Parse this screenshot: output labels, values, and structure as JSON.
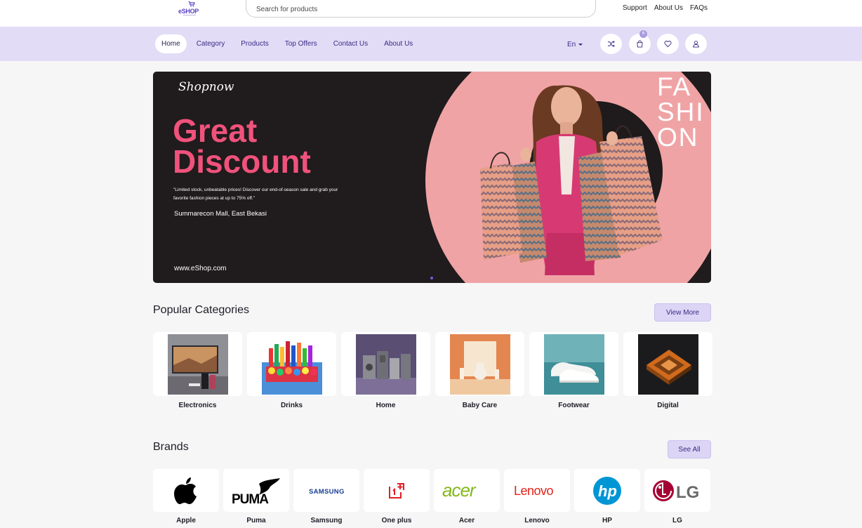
{
  "header": {
    "logo_text": "eSHOP",
    "search_placeholder": "Search for products",
    "links": [
      "Support",
      "About Us",
      "FAQs"
    ]
  },
  "nav": {
    "items": [
      "Home",
      "Category",
      "Products",
      "Top Offers",
      "Contact Us",
      "About Us"
    ],
    "active_index": 0,
    "language": "En",
    "cart_count": "6",
    "icons": [
      "shuffle-icon",
      "cart-icon",
      "heart-icon",
      "user-icon"
    ]
  },
  "hero": {
    "brand": "Shopnow",
    "headline_line1": "Great",
    "headline_line2": "Discount",
    "description": "\"Limited stock, unbeatable prices! Discover our end-of-season sale and grab your favorite fashion pieces at up to 75% off.\"",
    "location": "Summarecon Mall, East Bekasi",
    "url": "www.eShop.com",
    "fashion_line1": "FA",
    "fashion_line2": "SHI",
    "fashion_line3": "ON"
  },
  "categories": {
    "title": "Popular Categories",
    "button": "View More",
    "items": [
      "Electronics",
      "Drinks",
      "Home",
      "Baby Care",
      "Footwear",
      "Digital"
    ]
  },
  "brands": {
    "title": "Brands",
    "button": "See All",
    "items": [
      "Apple",
      "Puma",
      "Samsung",
      "One plus",
      "Acer",
      "Lenovo",
      "HP",
      "LG"
    ]
  },
  "colors": {
    "accent": "#3b2a86",
    "nav_bg": "#e2dcf6",
    "hero_pink": "#f0527c",
    "hero_circle": "#f0a3a5"
  }
}
